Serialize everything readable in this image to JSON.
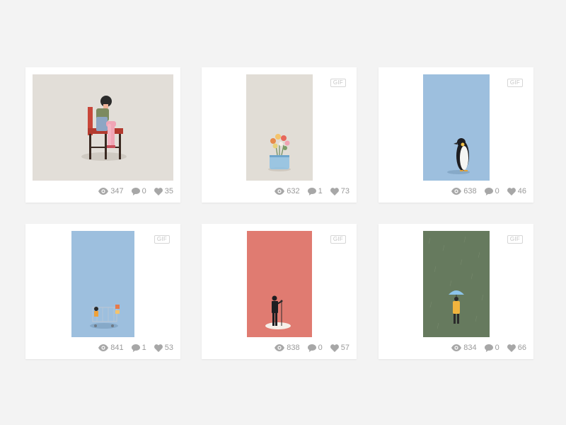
{
  "gif_label": "GIF",
  "cards": [
    {
      "gif": false,
      "views": "347",
      "comments": "0",
      "likes": "35",
      "bg": "#e2ded8"
    },
    {
      "gif": true,
      "views": "632",
      "comments": "1",
      "likes": "73",
      "bg": "#e1ddd6"
    },
    {
      "gif": true,
      "views": "638",
      "comments": "0",
      "likes": "46",
      "bg": "#9dbfde"
    },
    {
      "gif": true,
      "views": "841",
      "comments": "1",
      "likes": "53",
      "bg": "#9dbfde"
    },
    {
      "gif": true,
      "views": "838",
      "comments": "0",
      "likes": "57",
      "bg": "#e07b71"
    },
    {
      "gif": true,
      "views": "834",
      "comments": "0",
      "likes": "66",
      "bg": "#667a5e"
    }
  ],
  "icon_color": "#a7a7a7"
}
